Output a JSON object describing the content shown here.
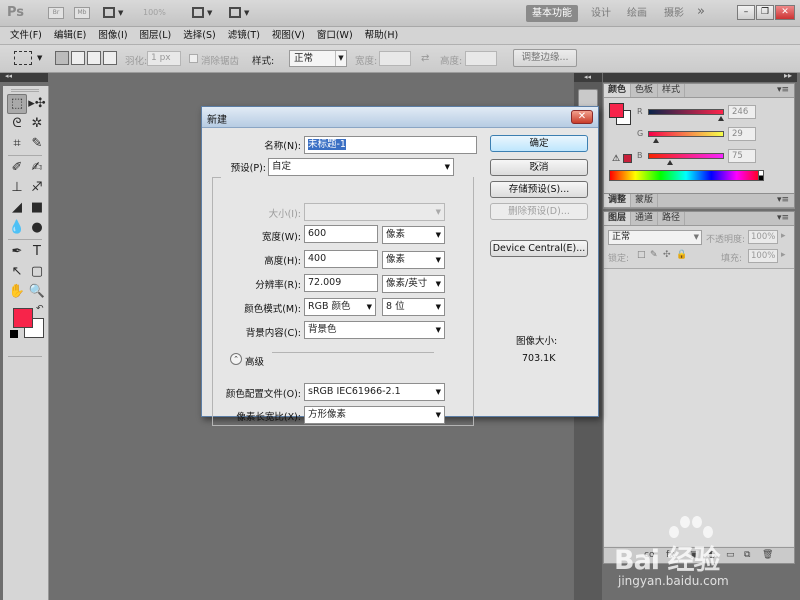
{
  "appbar": {
    "zoom": "100%",
    "workspaces": [
      "基本功能",
      "设计",
      "绘画",
      "摄影"
    ],
    "overflow": "»"
  },
  "menu": [
    "文件(F)",
    "编辑(E)",
    "图像(I)",
    "图层(L)",
    "选择(S)",
    "滤镜(T)",
    "视图(V)",
    "窗口(W)",
    "帮助(H)"
  ],
  "options": {
    "feather_label": "羽化:",
    "feather_value": "1 px",
    "antialias_label": "消除锯齿",
    "style_label": "样式:",
    "style_value": "正常",
    "width_label": "宽度:",
    "height_label": "高度:",
    "refine_edge": "调整边缘..."
  },
  "color_panel": {
    "tabs": [
      "颜色",
      "色板",
      "样式"
    ],
    "channels": [
      {
        "name": "R",
        "value": "246",
        "fraction": 0.96,
        "gradient": "#0a244a,#ff244a"
      },
      {
        "name": "G",
        "value": "29",
        "fraction": 0.11,
        "gradient": "#f6004a,#f6ff4a"
      },
      {
        "name": "B",
        "value": "75",
        "fraction": 0.29,
        "gradient": "#f62400,#f624ff"
      }
    ],
    "foreground": "#f7244a",
    "background": "#ffffff"
  },
  "adjust_panel": {
    "tabs": [
      "调整",
      "蒙版"
    ]
  },
  "layers_panel": {
    "tabs": [
      "图层",
      "通道",
      "路径"
    ],
    "blend_mode": "正常",
    "opacity_label": "不透明度:",
    "opacity_value": "100%",
    "lock_label": "锁定:",
    "fill_label": "填充:",
    "fill_value": "100%",
    "footer_icons": [
      "co",
      "fx."
    ]
  },
  "dialog": {
    "title": "新建",
    "name_label": "名称(N):",
    "name_value": "未标题-1",
    "preset_label": "预设(P):",
    "preset_value": "自定",
    "size_label": "大小(I):",
    "width_label": "宽度(W):",
    "width_value": "600",
    "width_unit": "像素",
    "height_label": "高度(H):",
    "height_value": "400",
    "height_unit": "像素",
    "resolution_label": "分辨率(R):",
    "resolution_value": "72.009",
    "resolution_unit": "像素/英寸",
    "color_mode_label": "颜色模式(M):",
    "color_mode_value": "RGB 颜色",
    "bit_depth_value": "8 位",
    "bg_contents_label": "背景内容(C):",
    "bg_contents_value": "背景色",
    "advanced_label": "高级",
    "color_profile_label": "颜色配置文件(O):",
    "color_profile_value": "sRGB IEC61966-2.1",
    "pixel_aspect_label": "像素长宽比(X):",
    "pixel_aspect_value": "方形像素",
    "ok_button": "确定",
    "cancel_button": "取消",
    "save_preset_button": "存储预设(S)...",
    "delete_preset_button": "删除预设(D)...",
    "device_central_button": "Device Central(E)...",
    "image_size_label": "图像大小:",
    "image_size_value": "703.1K"
  },
  "watermark": {
    "brand": "Bai 经验",
    "url": "jingyan.baidu.com"
  }
}
